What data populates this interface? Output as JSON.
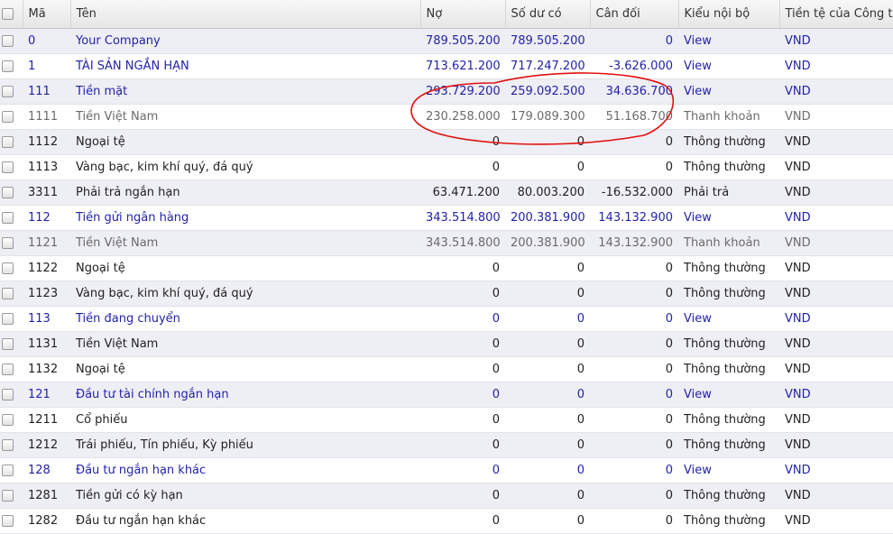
{
  "columns": {
    "code": "Mã",
    "name": "Tên",
    "debit": "Nợ",
    "credit": "Số dư có",
    "balance": "Cân đối",
    "internal_type": "Kiểu nội bộ",
    "company_currency": "Tiền tệ của Công ty"
  },
  "rows": [
    {
      "code": "0",
      "name": "Your Company",
      "debit": "789.505.200",
      "credit": "789.505.200",
      "balance": "0",
      "type": "View",
      "currency": "VND",
      "style": "view"
    },
    {
      "code": "1",
      "name": "TÀI SẢN NGẮN HẠN",
      "debit": "713.621.200",
      "credit": "717.247.200",
      "balance": "-3.626.000",
      "type": "View",
      "currency": "VND",
      "style": "view"
    },
    {
      "code": "111",
      "name": "Tiền mặt",
      "debit": "293.729.200",
      "credit": "259.092.500",
      "balance": "34.636.700",
      "type": "View",
      "currency": "VND",
      "style": "view"
    },
    {
      "code": "1111",
      "name": "Tiền Việt Nam",
      "debit": "230.258.000",
      "credit": "179.089.300",
      "balance": "51.168.700",
      "type": "Thanh khoản",
      "currency": "VND",
      "style": "muted"
    },
    {
      "code": "1112",
      "name": "Ngoại tệ",
      "debit": "0",
      "credit": "0",
      "balance": "0",
      "type": "Thông thường",
      "currency": "VND",
      "style": "normal"
    },
    {
      "code": "1113",
      "name": "Vàng bạc, kim khí quý, đá quý",
      "debit": "0",
      "credit": "0",
      "balance": "0",
      "type": "Thông thường",
      "currency": "VND",
      "style": "normal"
    },
    {
      "code": "3311",
      "name": "Phải trả ngắn hạn",
      "debit": "63.471.200",
      "credit": "80.003.200",
      "balance": "-16.532.000",
      "type": "Phải trả",
      "currency": "VND",
      "style": "normal"
    },
    {
      "code": "112",
      "name": "Tiền gửi ngân hàng",
      "debit": "343.514.800",
      "credit": "200.381.900",
      "balance": "143.132.900",
      "type": "View",
      "currency": "VND",
      "style": "view"
    },
    {
      "code": "1121",
      "name": "Tiền Việt Nam",
      "debit": "343.514.800",
      "credit": "200.381.900",
      "balance": "143.132.900",
      "type": "Thanh khoản",
      "currency": "VND",
      "style": "muted"
    },
    {
      "code": "1122",
      "name": "Ngoại tệ",
      "debit": "0",
      "credit": "0",
      "balance": "0",
      "type": "Thông thường",
      "currency": "VND",
      "style": "normal"
    },
    {
      "code": "1123",
      "name": "Vàng bạc, kim khí quý, đá quý",
      "debit": "0",
      "credit": "0",
      "balance": "0",
      "type": "Thông thường",
      "currency": "VND",
      "style": "normal"
    },
    {
      "code": "113",
      "name": "Tiền đang chuyển",
      "debit": "0",
      "credit": "0",
      "balance": "0",
      "type": "View",
      "currency": "VND",
      "style": "view"
    },
    {
      "code": "1131",
      "name": "Tiền Việt Nam",
      "debit": "0",
      "credit": "0",
      "balance": "0",
      "type": "Thông thường",
      "currency": "VND",
      "style": "normal"
    },
    {
      "code": "1132",
      "name": "Ngoại tệ",
      "debit": "0",
      "credit": "0",
      "balance": "0",
      "type": "Thông thường",
      "currency": "VND",
      "style": "normal"
    },
    {
      "code": "121",
      "name": "Đầu tư tài chính ngắn hạn",
      "debit": "0",
      "credit": "0",
      "balance": "0",
      "type": "View",
      "currency": "VND",
      "style": "view"
    },
    {
      "code": "1211",
      "name": "Cổ phiếu",
      "debit": "0",
      "credit": "0",
      "balance": "0",
      "type": "Thông thường",
      "currency": "VND",
      "style": "normal"
    },
    {
      "code": "1212",
      "name": "Trái phiếu, Tín phiếu, Kỳ phiếu",
      "debit": "0",
      "credit": "0",
      "balance": "0",
      "type": "Thông thường",
      "currency": "VND",
      "style": "normal"
    },
    {
      "code": "128",
      "name": "Đầu tư ngắn hạn khác",
      "debit": "0",
      "credit": "0",
      "balance": "0",
      "type": "View",
      "currency": "VND",
      "style": "view"
    },
    {
      "code": "1281",
      "name": "Tiền gửi có kỳ hạn",
      "debit": "0",
      "credit": "0",
      "balance": "0",
      "type": "Thông thường",
      "currency": "VND",
      "style": "normal"
    },
    {
      "code": "1282",
      "name": "Đầu tư ngắn hạn khác",
      "debit": "0",
      "credit": "0",
      "balance": "0",
      "type": "Thông thường",
      "currency": "VND",
      "style": "normal"
    }
  ],
  "colors": {
    "link": "#2323a8",
    "annotation": "#e01010",
    "row_alt": "#eeeef5"
  }
}
